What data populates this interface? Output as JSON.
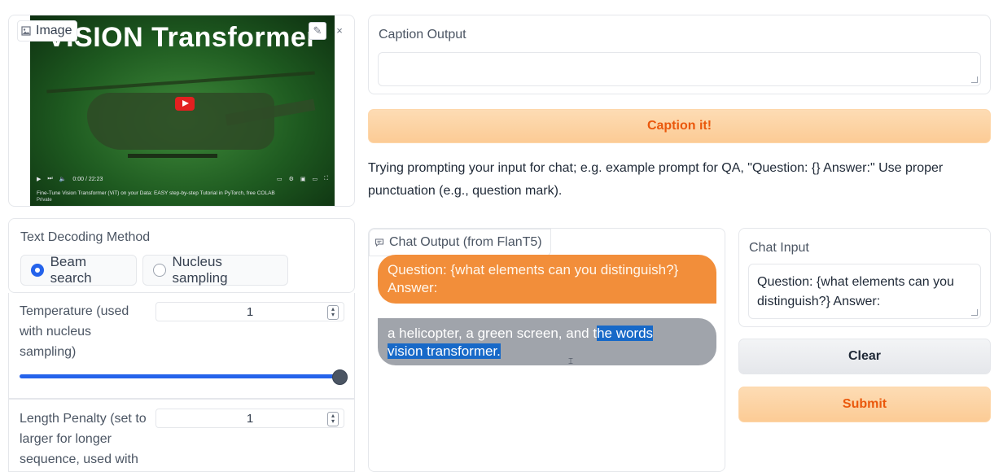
{
  "image_panel": {
    "label": "Image",
    "icon": "image-icon",
    "edit_icon": "pencil-icon",
    "close_icon": "close-icon",
    "video": {
      "title": "VISION Transformer",
      "time": "0:00 / 22:23",
      "caption": "Fine-Tune Vision Transformer (ViT) on your Data: EASY step-by-step Tutorial in PyTorch, free COLAB",
      "private": "Private"
    }
  },
  "decoding": {
    "label": "Text Decoding Method",
    "options": [
      {
        "label": "Beam search",
        "selected": true
      },
      {
        "label": "Nucleus sampling",
        "selected": false
      }
    ]
  },
  "temperature": {
    "label": "Temperature (used with nucleus sampling)",
    "value": "1",
    "slider_fraction": 1.0
  },
  "length_penalty": {
    "label": "Length Penalty (set to larger for longer sequence, used with",
    "value": "1"
  },
  "caption": {
    "label": "Caption Output",
    "value": "",
    "button_label": "Caption it!"
  },
  "hint": "Trying prompting your input for chat; e.g. example prompt for QA, \"Question: {} Answer:\" Use proper punctuation (e.g., question mark).",
  "chat_output": {
    "label": "Chat Output (from FlanT5)",
    "icon": "chat-icon",
    "messages": [
      {
        "role": "user",
        "text": "Question: {what elements can you distinguish?} Answer:"
      },
      {
        "role": "bot",
        "text_plain": "a helicopter, a green screen, and t",
        "text_selected_1": "he words",
        "text_selected_2": "vision transformer."
      }
    ]
  },
  "chat_input": {
    "label": "Chat Input",
    "value": "Question: {what elements can you distinguish?} Answer:"
  },
  "buttons": {
    "clear": "Clear",
    "submit": "Submit"
  },
  "colors": {
    "accent": "#2563eb",
    "orange_button": "#fccb95",
    "orange_text": "#ea580c",
    "user_bubble": "#f28e3a",
    "bot_bubble": "#a0a4ab",
    "selection": "#1769c8"
  }
}
